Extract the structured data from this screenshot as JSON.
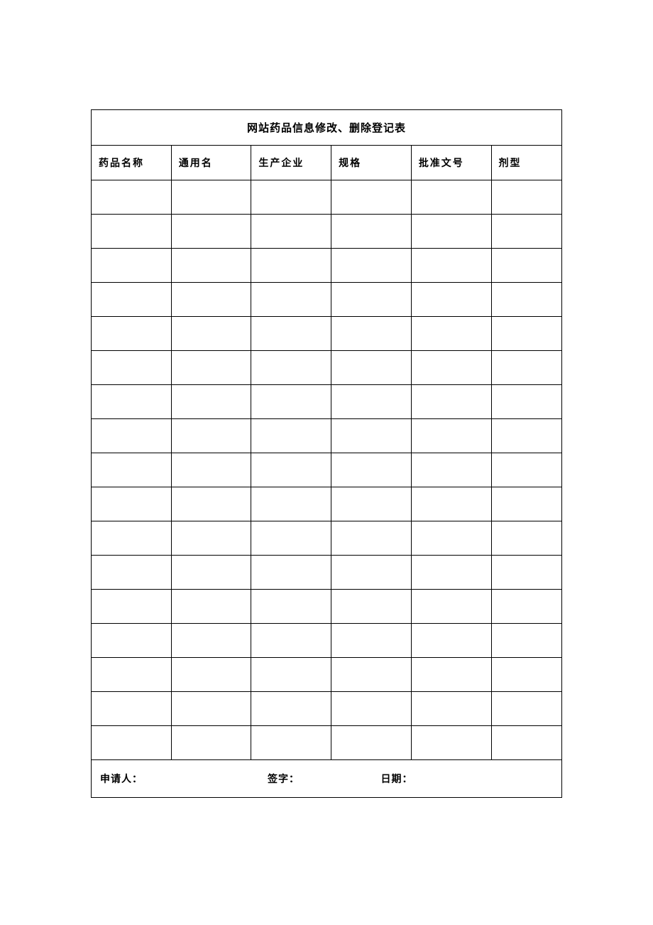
{
  "title": "网站药品信息修改、删除登记表",
  "columns": [
    "药品名称",
    "通用名",
    "生产企业",
    "规格",
    "批准文号",
    "剂型"
  ],
  "rows": [
    [
      "",
      "",
      "",
      "",
      "",
      ""
    ],
    [
      "",
      "",
      "",
      "",
      "",
      ""
    ],
    [
      "",
      "",
      "",
      "",
      "",
      ""
    ],
    [
      "",
      "",
      "",
      "",
      "",
      ""
    ],
    [
      "",
      "",
      "",
      "",
      "",
      ""
    ],
    [
      "",
      "",
      "",
      "",
      "",
      ""
    ],
    [
      "",
      "",
      "",
      "",
      "",
      ""
    ],
    [
      "",
      "",
      "",
      "",
      "",
      ""
    ],
    [
      "",
      "",
      "",
      "",
      "",
      ""
    ],
    [
      "",
      "",
      "",
      "",
      "",
      ""
    ],
    [
      "",
      "",
      "",
      "",
      "",
      ""
    ],
    [
      "",
      "",
      "",
      "",
      "",
      ""
    ],
    [
      "",
      "",
      "",
      "",
      "",
      ""
    ],
    [
      "",
      "",
      "",
      "",
      "",
      ""
    ],
    [
      "",
      "",
      "",
      "",
      "",
      ""
    ],
    [
      "",
      "",
      "",
      "",
      "",
      ""
    ],
    [
      "",
      "",
      "",
      "",
      "",
      ""
    ]
  ],
  "footer": {
    "applicant_label": "申请人：",
    "signature_label": "签字：",
    "date_label": "日期："
  }
}
